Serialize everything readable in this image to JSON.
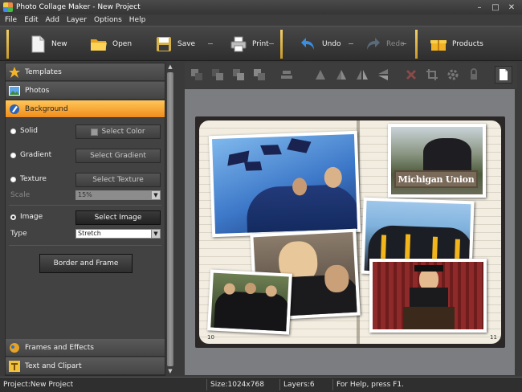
{
  "window": {
    "title": "Photo Collage Maker - New Project"
  },
  "menu": [
    "File",
    "Edit",
    "Add",
    "Layer",
    "Options",
    "Help"
  ],
  "toolbar": {
    "new": "New",
    "open": "Open",
    "save": "Save",
    "print": "Print",
    "undo": "Undo",
    "redo": "Redo",
    "products": "Products"
  },
  "panel": {
    "templates": "Templates",
    "photos": "Photos",
    "background": "Background",
    "solid": "Solid",
    "select_color": "Select Color",
    "gradient": "Gradient",
    "select_gradient": "Select Gradient",
    "texture": "Texture",
    "select_texture": "Select Texture",
    "scale_label": "Scale",
    "scale_value": "15%",
    "image": "Image",
    "select_image": "Select Image",
    "type_label": "Type",
    "type_value": "Stretch",
    "border_frame": "Border and Frame",
    "frames_effects": "Frames and Effects",
    "text_clipart": "Text and Clipart"
  },
  "page": {
    "left_number": "10",
    "right_number": "11"
  },
  "photos": {
    "sign_text": "Michigan Union"
  },
  "status": {
    "project": "Project:New Project",
    "size": "Size:1024x768",
    "layers": "Layers:6",
    "help": "For Help, press F1."
  },
  "colors": {
    "accent": "#f5a623",
    "active_header": "#f08d1a",
    "workspace": "#7b7d80"
  }
}
